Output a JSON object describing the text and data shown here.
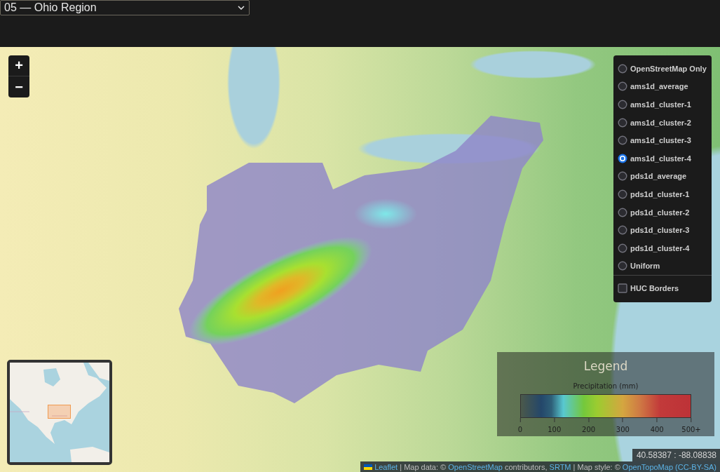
{
  "region_select": {
    "value": "05 — Ohio Region"
  },
  "zoom_controls": {
    "buttons": [
      "+",
      "−"
    ]
  },
  "layer_control": {
    "base_layers": [
      {
        "label": "OpenStreetMap Only",
        "selected": false
      },
      {
        "label": "ams1d_average",
        "selected": false
      },
      {
        "label": "ams1d_cluster-1",
        "selected": false
      },
      {
        "label": "ams1d_cluster-2",
        "selected": false
      },
      {
        "label": "ams1d_cluster-3",
        "selected": false
      },
      {
        "label": "ams1d_cluster-4",
        "selected": true
      },
      {
        "label": "pds1d_average",
        "selected": false
      },
      {
        "label": "pds1d_cluster-1",
        "selected": false
      },
      {
        "label": "pds1d_cluster-2",
        "selected": false
      },
      {
        "label": "pds1d_cluster-3",
        "selected": false
      },
      {
        "label": "pds1d_cluster-4",
        "selected": false
      },
      {
        "label": "Uniform",
        "selected": false
      }
    ],
    "overlays": [
      {
        "label": "HUC Borders",
        "checked": false
      }
    ]
  },
  "legend": {
    "title": "Legend",
    "scale_label": "Precipitation (mm)",
    "ticks": [
      "0",
      "100",
      "200",
      "300",
      "400",
      "500+"
    ]
  },
  "coordinates": "40.58387 : -88.08838",
  "attribution": {
    "parts": [
      {
        "kind": "link",
        "text": "Leaflet"
      },
      {
        "kind": "text",
        "text": " | Map data: © "
      },
      {
        "kind": "link",
        "text": "OpenStreetMap"
      },
      {
        "kind": "text",
        "text": " contributors, "
      },
      {
        "kind": "link",
        "text": "SRTM"
      },
      {
        "kind": "text",
        "text": " | Map style: © "
      },
      {
        "kind": "link",
        "text": "OpenTopoMap"
      },
      {
        "kind": "link",
        "text": "(CC-BY-SA)"
      }
    ]
  }
}
